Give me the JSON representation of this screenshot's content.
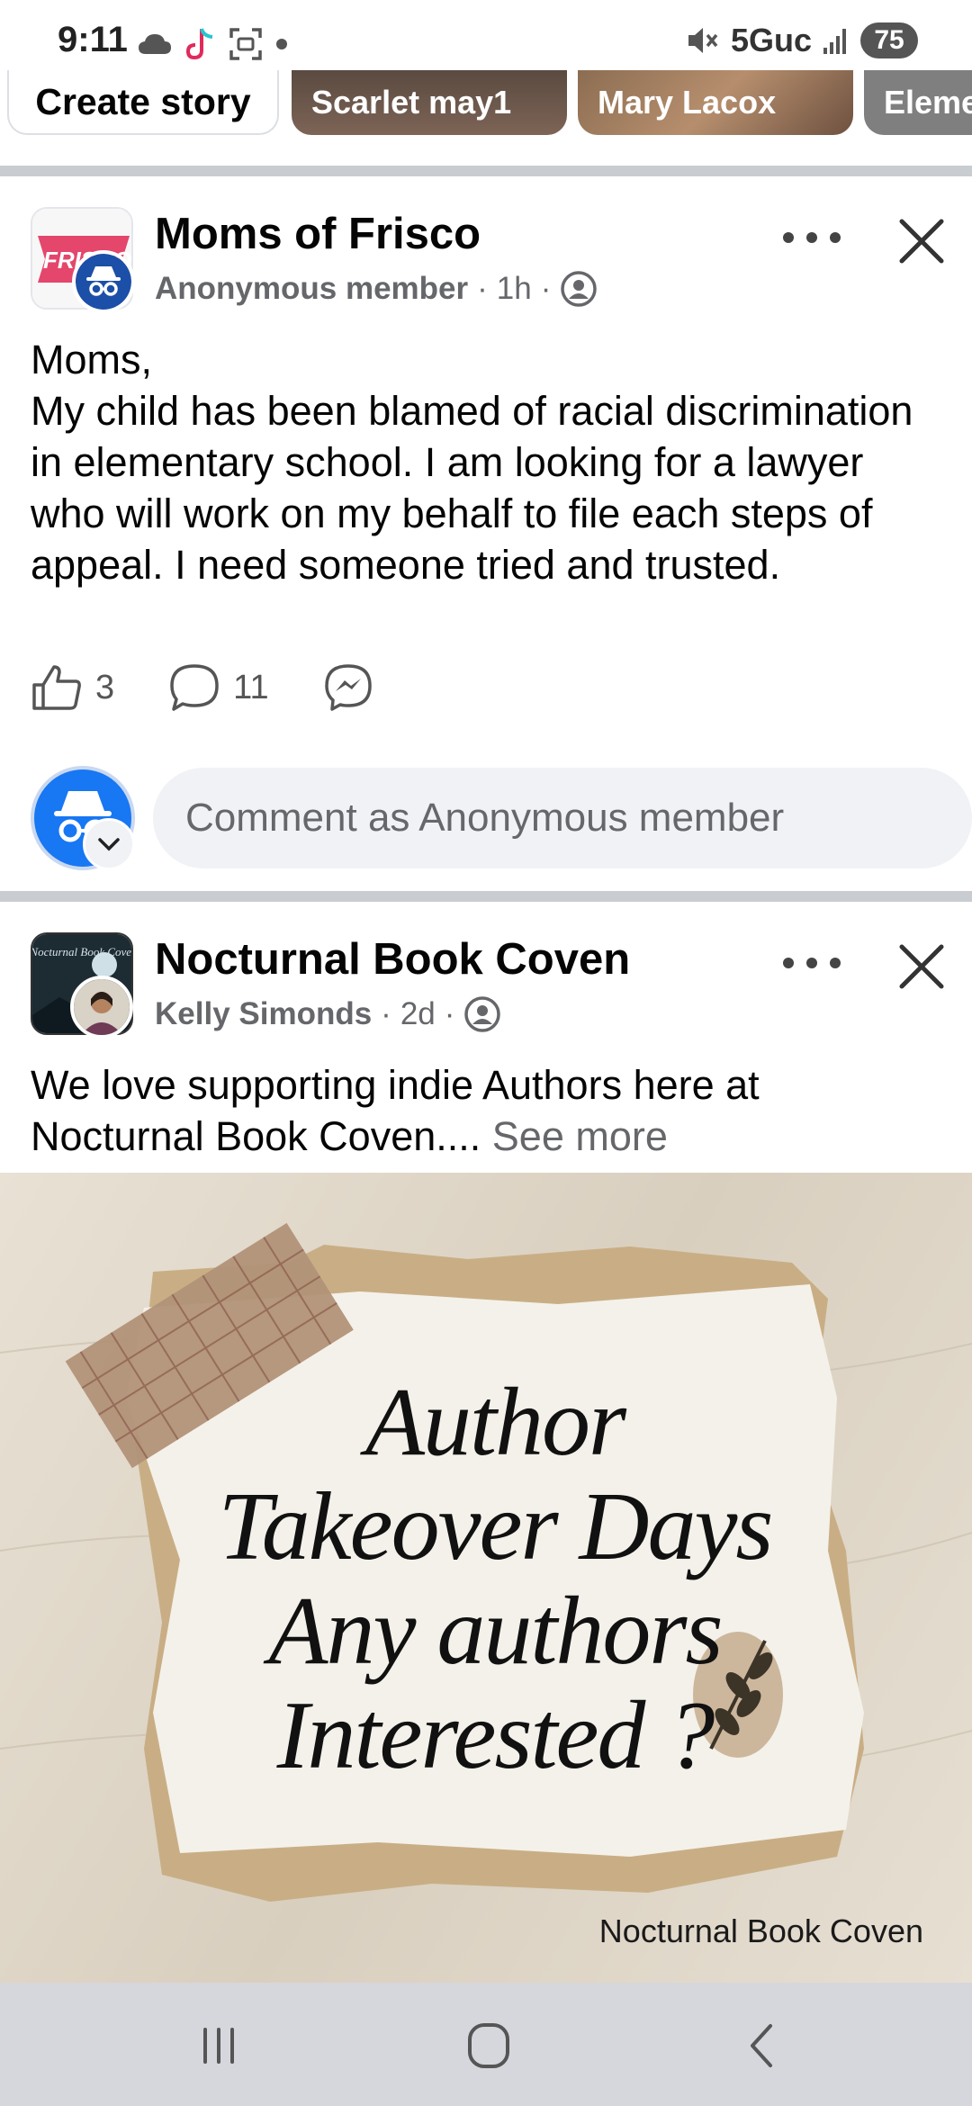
{
  "status_bar": {
    "time": "9:11",
    "network": "5Guc",
    "battery": "75",
    "icons_left": [
      "cloud-icon",
      "tiktok-icon",
      "screenshot-icon",
      "dot-icon"
    ],
    "icons_right": [
      "mute-icon",
      "signal-icon",
      "battery-icon"
    ]
  },
  "stories": {
    "create_label": "Create story",
    "items": [
      {
        "name": "Scarlet may1"
      },
      {
        "name": "Mary Lacox"
      },
      {
        "name": "Eleme"
      }
    ]
  },
  "post1": {
    "group_name": "Moms of Frisco",
    "author": "Anonymous member",
    "time": "1h",
    "body": "Moms,\nMy child has been blamed of racial discrimination in elementary school. I am looking for a lawyer who will work on my behalf to file each steps of appeal. I need someone tried and trusted.",
    "likes": "3",
    "comments": "11",
    "comment_placeholder": "Comment as Anonymous member",
    "group_logo_text": "FRISCO"
  },
  "post2": {
    "group_name": "Nocturnal Book Coven",
    "author": "Kelly Simonds",
    "time": "2d",
    "body": "We love supporting indie Authors here at Nocturnal Book Coven....",
    "see_more": "See more",
    "image_headline": "Author\nTakeover Days\nAny authors\nInterested ?",
    "image_credit": "Nocturnal Book Coven",
    "group_logo_text": "Nocturnal Book Coven"
  },
  "colors": {
    "accent": "#1877f2",
    "divider": "#c9ccd1",
    "muted_text": "#65676b",
    "nav_bar": "#d6d7dc"
  },
  "nav": [
    "recents-icon",
    "home-icon",
    "back-icon"
  ]
}
